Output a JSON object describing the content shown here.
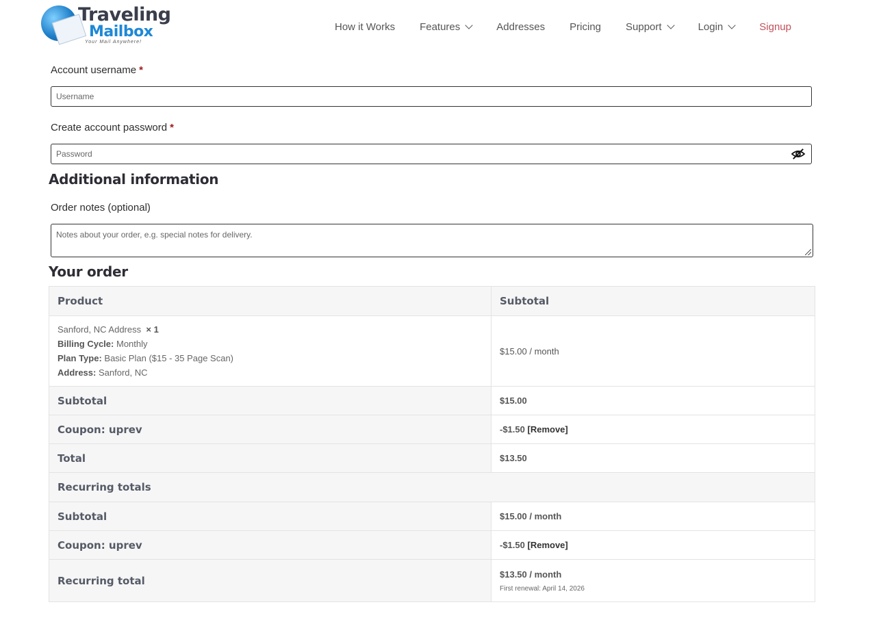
{
  "brand": {
    "name_line1": "Traveling",
    "name_line2": "Mailbox",
    "tagline": "Your Mail Anywhere!"
  },
  "nav": {
    "how": "How it Works",
    "features": "Features",
    "addresses": "Addresses",
    "pricing": "Pricing",
    "support": "Support",
    "login": "Login",
    "signup": "Signup"
  },
  "form": {
    "username_label": "Account username",
    "username_placeholder": "Username",
    "password_label": "Create account password",
    "password_placeholder": "Password",
    "required_mark": "*",
    "additional_heading": "Additional information",
    "notes_label": "Order notes (optional)",
    "notes_placeholder": "Notes about your order, e.g. special notes for delivery."
  },
  "order": {
    "heading": "Your order",
    "col_product": "Product",
    "col_subtotal": "Subtotal",
    "item": {
      "name": "Sanford, NC Address",
      "qty": "× 1",
      "billing_label": "Billing Cycle:",
      "billing_value": "Monthly",
      "plan_label": "Plan Type:",
      "plan_value": "Basic Plan ($15 - 35 Page Scan)",
      "address_label": "Address:",
      "address_value": "Sanford, NC",
      "price": "$15.00 / month"
    },
    "subtotal_label": "Subtotal",
    "subtotal_value": "$15.00",
    "coupon_label": "Coupon: uprev",
    "coupon_value": "-$1.50",
    "remove_label": "[Remove]",
    "total_label": "Total",
    "total_value": "$13.50",
    "recurring_heading": "Recurring totals",
    "rec_subtotal_label": "Subtotal",
    "rec_subtotal_value": "$15.00 / month",
    "rec_coupon_label": "Coupon: uprev",
    "rec_coupon_value": "-$1.50",
    "rec_total_label": "Recurring total",
    "rec_total_value": "$13.50 / month",
    "first_renewal": "First renewal: April 14, 2026"
  },
  "colors": {
    "signup": "#c0525a",
    "required": "#a01b1b",
    "table_header_bg": "#f6f6f6"
  }
}
